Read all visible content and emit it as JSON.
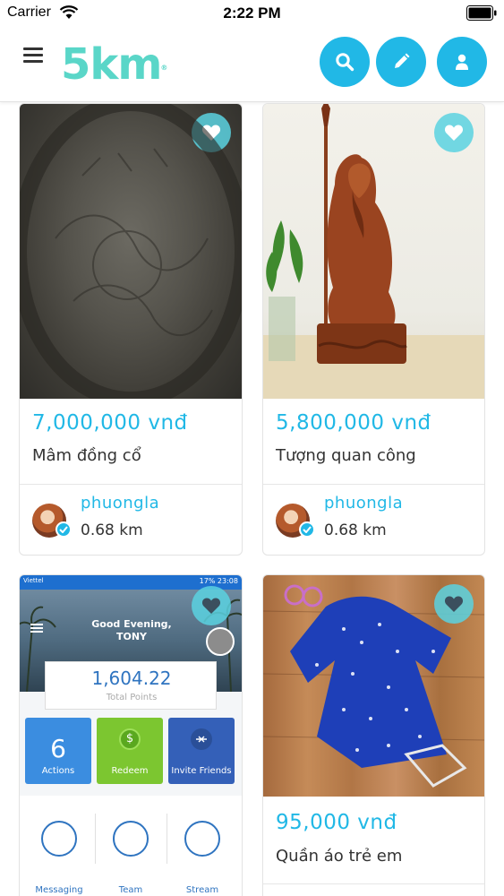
{
  "status_bar": {
    "carrier": "Carrier",
    "time": "2:22 PM"
  },
  "header": {
    "logo": "5km",
    "logo_mark": "®",
    "menu_icon": "hamburger-icon",
    "actions": [
      {
        "name": "search",
        "icon": "search-icon"
      },
      {
        "name": "post",
        "icon": "pencil-icon"
      },
      {
        "name": "profile",
        "icon": "user-icon"
      }
    ]
  },
  "colors": {
    "accent": "#21b8e6",
    "logo": "#5ad6c8",
    "text": "#333333"
  },
  "listings": [
    {
      "price": "7,000,000 vnđ",
      "title": "Mâm đồng cổ",
      "seller": "phuongla",
      "distance": "0.68 km"
    },
    {
      "price": "5,800,000 vnđ",
      "title": "Tượng quan công",
      "seller": "phuongla",
      "distance": "0.68 km"
    },
    {
      "screenshot": {
        "status_left": "Viettel",
        "status_right": "17%  23:08",
        "greeting": "Good Evening,",
        "name": "TONY",
        "points": "1,604.22",
        "points_label": "Total Points",
        "tiles": [
          {
            "value": "6",
            "label": "Actions"
          },
          {
            "value": "$",
            "label": "Redeem"
          },
          {
            "value": "",
            "label": "Invite Friends"
          }
        ],
        "bottom_items": [
          "Messaging",
          "Team",
          "Stream"
        ]
      }
    },
    {
      "price": "95,000 vnđ",
      "title": "Quần áo trẻ em"
    }
  ]
}
